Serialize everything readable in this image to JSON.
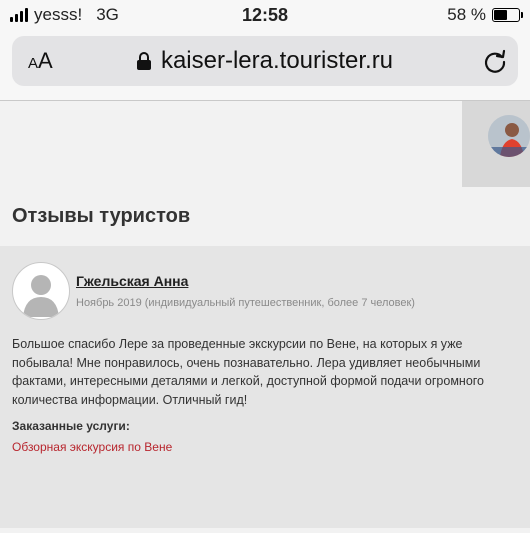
{
  "status_bar": {
    "carrier": "yesss!",
    "network": "3G",
    "time": "12:58",
    "battery": "58 %",
    "battery_level": 0.58
  },
  "browser": {
    "text_size_label": "AA",
    "url": "kaiser-lera.tourister.ru"
  },
  "section": {
    "title": "Отзывы туристов"
  },
  "review": {
    "author": "Гжельская Анна",
    "meta": "Ноябрь 2019 (индивидуальный путешественник, более 7 человек)",
    "text": "Большое спасибо Лере за проведенные экскурсии по Вене, на которых я уже побывала! Мне понравилось, очень познавательно. Лера удивляет необычными фактами, интересными деталями и легкой, доступной формой подачи огромного количества информации. Отличный гид!",
    "services_label": "Заказанные услуги:",
    "service": "Обзорная экскурсия по Вене"
  },
  "colors": {
    "link_red": "#b8262e",
    "review_bg": "#e5e5e5",
    "side_panel": "#d8d8d8"
  }
}
